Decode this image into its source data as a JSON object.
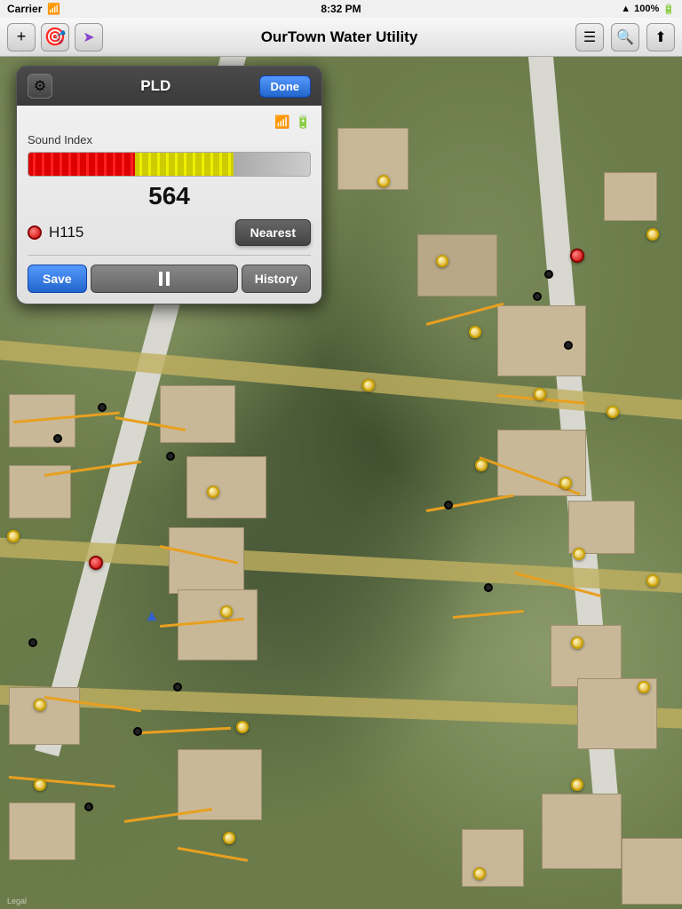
{
  "status_bar": {
    "carrier": "Carrier",
    "time": "8:32 PM",
    "battery": "100%",
    "signal_bars": "▌▌▌▌▌",
    "wifi": "📶",
    "gps_arrow": "▲"
  },
  "nav_bar": {
    "title": "OurTown Water Utility",
    "add_btn": "+",
    "target_btn": "⊙",
    "location_btn": "➤",
    "list_btn": "≡",
    "search_btn": "🔍",
    "share_btn": "↑"
  },
  "pld_panel": {
    "title": "PLD",
    "done_label": "Done",
    "gear_icon": "⚙",
    "sound_index_label": "Sound Index",
    "sound_value": "564",
    "device_id": "H115",
    "nearest_label": "Nearest",
    "save_label": "Save",
    "history_label": "History",
    "wifi_icon": "📶",
    "battery_icon": "🔋",
    "meter_red_pct": 38,
    "meter_yellow_pct": 35
  },
  "map": {
    "legal_text": "Legal"
  }
}
